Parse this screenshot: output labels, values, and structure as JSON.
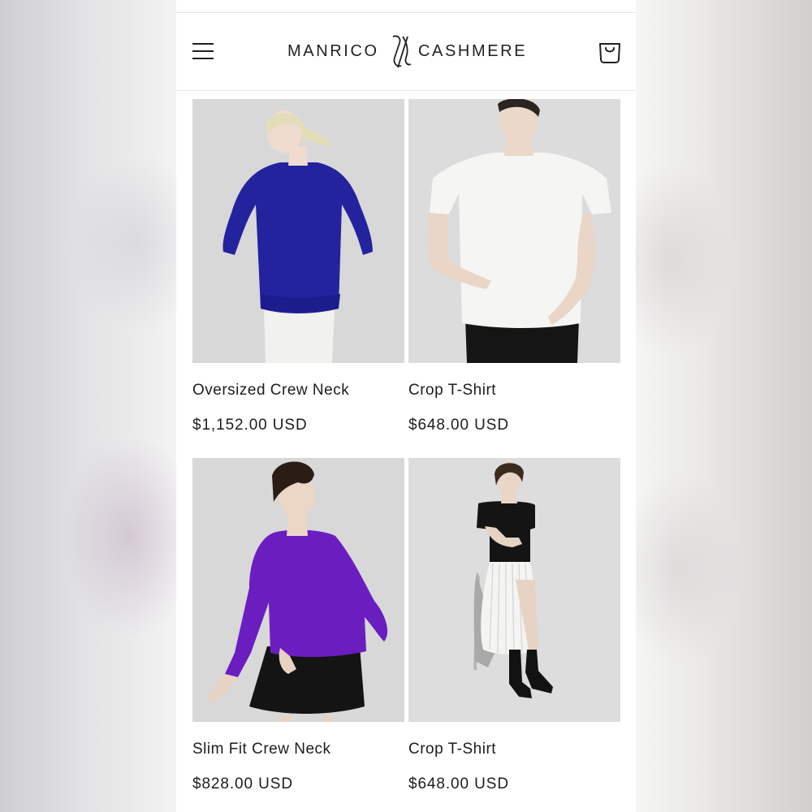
{
  "header": {
    "brand_left": "MANRICO",
    "brand_right": "CASHMERE",
    "menu_icon": "hamburger-menu-icon",
    "cart_icon": "shopping-bag-icon"
  },
  "products": [
    {
      "name": "Oversized Crew Neck",
      "price": "$1,152.00 USD",
      "image": "model-blue-oversized-sweater",
      "color": "#24239e"
    },
    {
      "name": "Crop T-Shirt",
      "price": "$648.00 USD",
      "image": "model-white-crop-tshirt",
      "color": "#f7f7f7"
    },
    {
      "name": "Slim Fit Crew Neck",
      "price": "$828.00 USD",
      "image": "model-purple-slim-sweater",
      "color": "#6a1ec0"
    },
    {
      "name": "Crop T-Shirt",
      "price": "$648.00 USD",
      "image": "model-black-crop-tshirt-pleated-skirt",
      "color": "#111111"
    }
  ],
  "colors": {
    "background": "#ffffff",
    "text": "#1d1d1d",
    "photo_backdrop": "#d9d9da"
  }
}
